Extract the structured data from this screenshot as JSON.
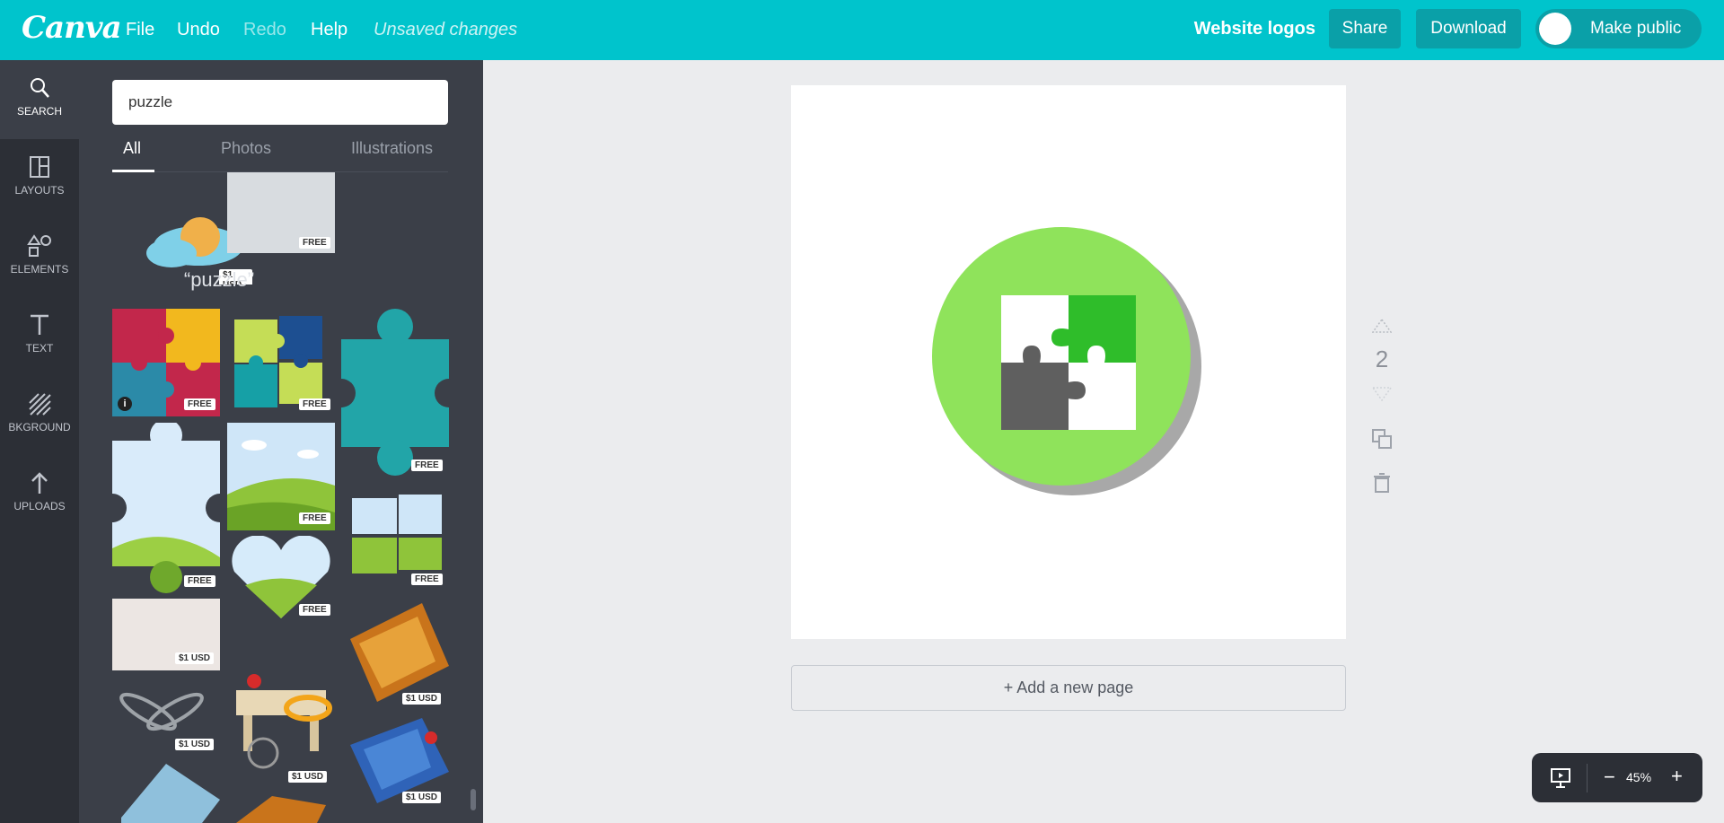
{
  "topbar": {
    "logo": "Canva",
    "menu": {
      "file": "File",
      "undo": "Undo",
      "redo": "Redo",
      "help": "Help",
      "unsaved": "Unsaved changes"
    },
    "design_name": "Website logos",
    "share": "Share",
    "download": "Download",
    "make_public": "Make public"
  },
  "rail": {
    "search": "SEARCH",
    "layouts": "LAYOUTS",
    "elements": "ELEMENTS",
    "text": "TEXT",
    "background": "BKGROUND",
    "uploads": "UPLOADS"
  },
  "panel": {
    "search_value": "puzzle",
    "tabs": {
      "all": "All",
      "photos": "Photos",
      "illustrations": "Illustrations"
    },
    "section_title": "“puzzle”",
    "badges": {
      "free": "FREE",
      "usd": "$1 USD"
    }
  },
  "canvas": {
    "page_number": "2",
    "add_page": "+ Add a new page",
    "colors": {
      "circle": "#8fe35b",
      "shadow": "#a8a8a8",
      "green_piece": "#2fbd2a",
      "gray_piece": "#5f5f5f"
    }
  },
  "zoom": {
    "level": "45%"
  }
}
